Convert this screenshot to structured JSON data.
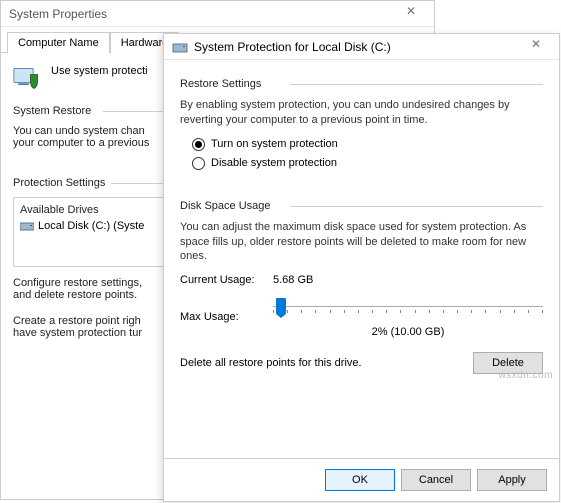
{
  "back_window": {
    "title": "System Properties",
    "tabs": [
      "Computer Name",
      "Hardware"
    ],
    "intro": "Use system protecti",
    "group_restore": "System Restore",
    "restore_text1": "You can undo system chan",
    "restore_text2": "your computer to a previous",
    "group_protection": "Protection Settings",
    "drives_header": "Available Drives",
    "drive0": "Local Disk (C:) (Syste",
    "configure_text": "Configure restore settings,\nand delete restore points.",
    "create_text": "Create a restore point righ\nhave system protection tur"
  },
  "front_window": {
    "title": "System Protection for Local Disk (C:)",
    "section_restore": "Restore Settings",
    "restore_desc": "By enabling system protection, you can undo undesired changes by reverting your computer to a previous point in time.",
    "radio_on": "Turn on system protection",
    "radio_off": "Disable system protection",
    "section_disk": "Disk Space Usage",
    "disk_desc": "You can adjust the maximum disk space used for system protection. As space fills up, older restore points will be deleted to make room for new ones.",
    "current_usage_label": "Current Usage:",
    "current_usage_value": "5.68 GB",
    "max_usage_label": "Max Usage:",
    "slider_value_label": "2% (10.00 GB)",
    "delete_text": "Delete all restore points for this drive.",
    "delete_btn": "Delete",
    "ok_btn": "OK",
    "cancel_btn": "Cancel",
    "apply_btn": "Apply"
  },
  "watermark": "wsxdn.com"
}
